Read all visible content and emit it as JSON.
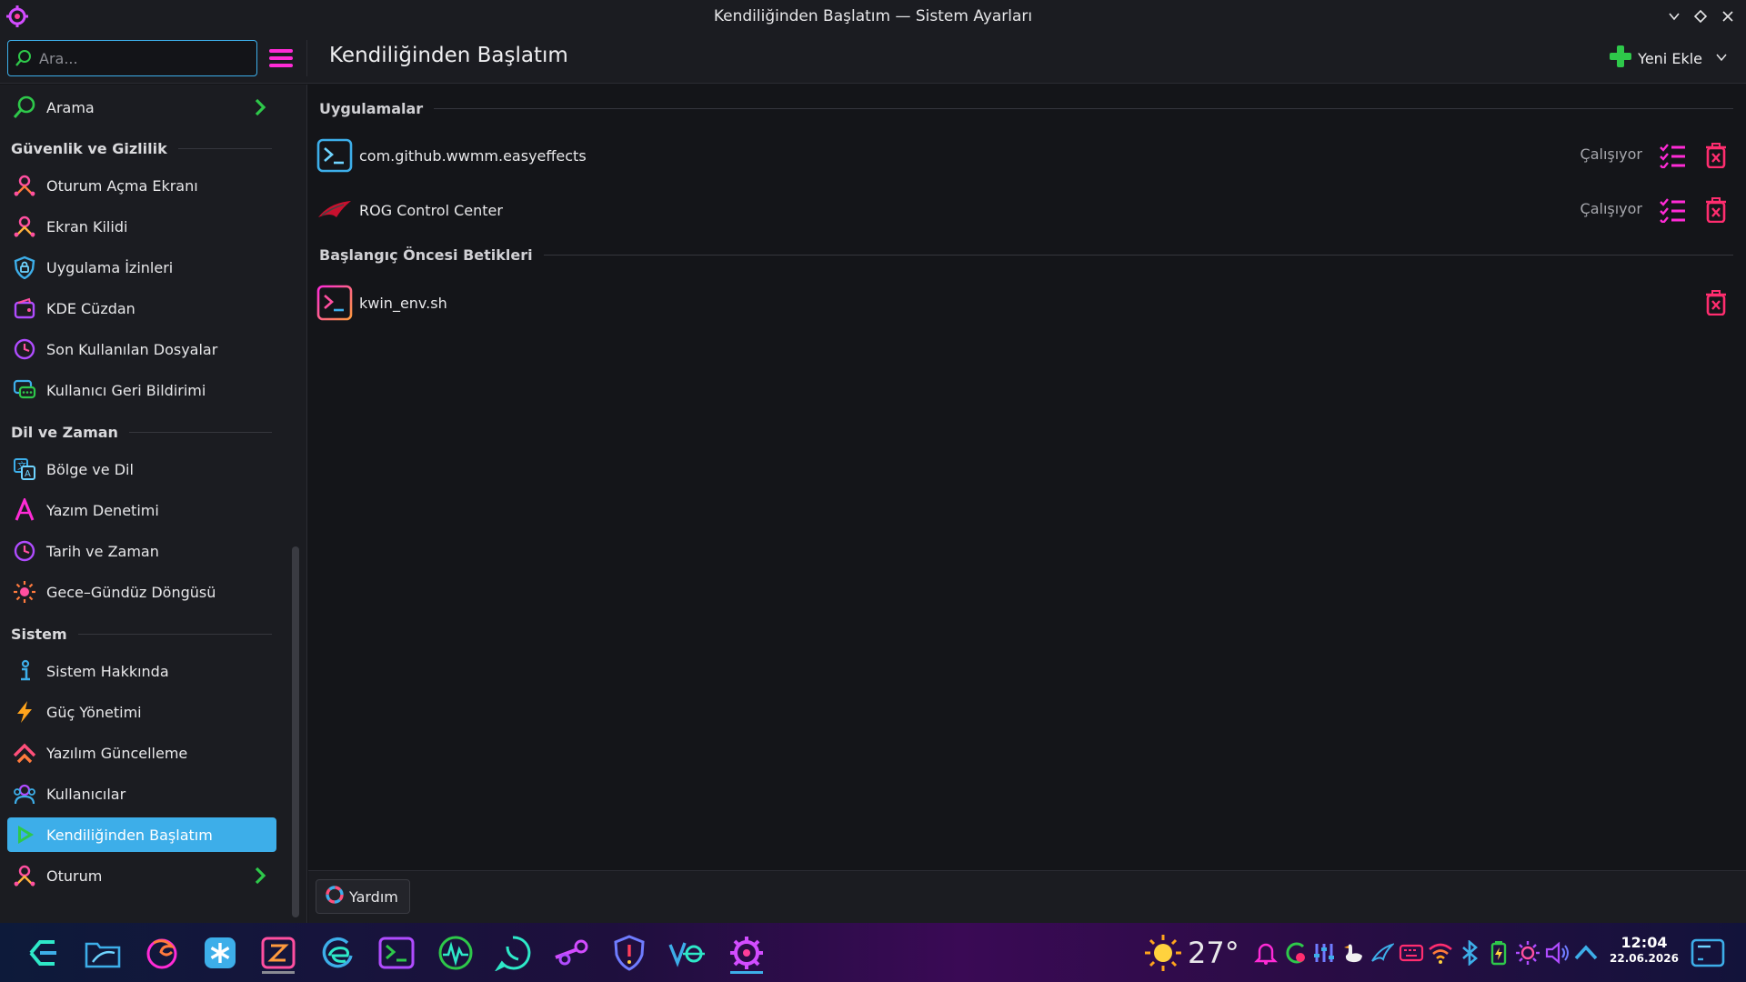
{
  "window": {
    "title": "Kendiliğinden Başlatım — Sistem Ayarları"
  },
  "search": {
    "placeholder": "Ara..."
  },
  "page": {
    "title": "Kendiliğinden Başlatım",
    "add_new_label": "Yeni Ekle"
  },
  "sidebar": {
    "search_item": "Arama",
    "sections": [
      {
        "title": "Güvenlik ve Gizlilik",
        "items": [
          "Oturum Açma Ekranı",
          "Ekran Kilidi",
          "Uygulama İzinleri",
          "KDE Cüzdan",
          "Son Kullanılan Dosyalar",
          "Kullanıcı Geri Bildirimi"
        ]
      },
      {
        "title": "Dil ve Zaman",
        "items": [
          "Bölge ve Dil",
          "Yazım Denetimi",
          "Tarih ve Zaman",
          "Gece–Gündüz Döngüsü"
        ]
      },
      {
        "title": "Sistem",
        "items": [
          "Sistem Hakkında",
          "Güç Yönetimi",
          "Yazılım Güncelleme",
          "Kullanıcılar",
          "Kendiliğinden Başlatım",
          "Oturum"
        ]
      }
    ],
    "active_item": "Kendiliğinden Başlatım"
  },
  "main": {
    "groups": [
      {
        "title": "Uygulamalar",
        "entries": [
          {
            "name": "com.github.wwmm.easyeffects",
            "status": "Çalışıyor"
          },
          {
            "name": "ROG Control Center",
            "status": "Çalışıyor"
          }
        ]
      },
      {
        "title": "Başlangıç Öncesi Betikleri",
        "entries": [
          {
            "name": "kwin_env.sh",
            "status": ""
          }
        ]
      }
    ]
  },
  "footer": {
    "help_label": "Yardım"
  },
  "taskbar": {
    "apps": [
      "kde-connect-icon",
      "dolphin-icon",
      "firefox-icon",
      "kde-asterisk-icon",
      "zed-editor-icon",
      "edge-browser-icon",
      "terminal-icon",
      "system-monitor-icon",
      "whatsapp-icon",
      "steam-icon",
      "security-shield-icon",
      "vpn-icon",
      "system-settings-icon"
    ],
    "weather": {
      "temperature": "27°",
      "icon": "sun-icon"
    },
    "clock": {
      "time": "12:04",
      "date": "22.06.2026"
    }
  },
  "colors": {
    "accent": "#3daee9",
    "magenta": "#ff2bd6",
    "delete": "#ff2d6f",
    "green": "#2ec84a"
  }
}
